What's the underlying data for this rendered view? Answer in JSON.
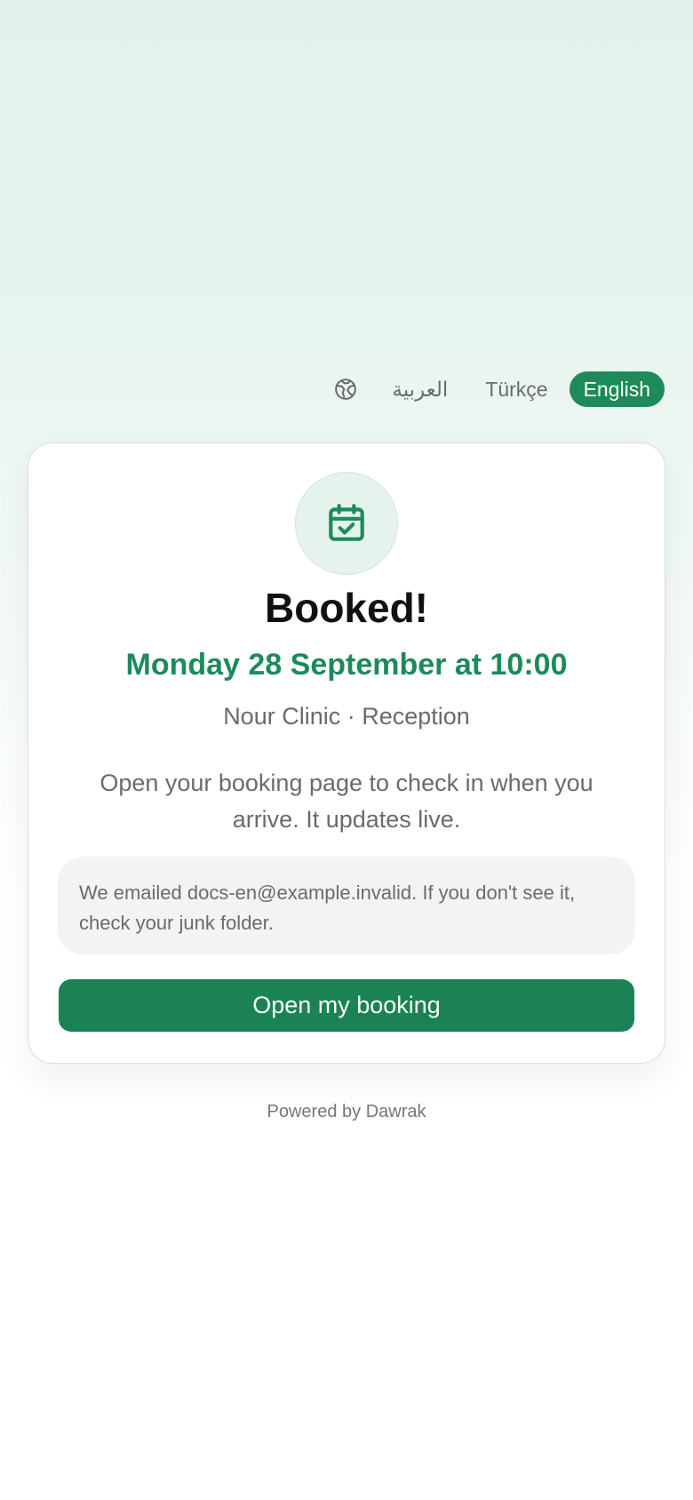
{
  "language_switcher": {
    "icon": "globe-icon",
    "options": [
      {
        "label": "العربية",
        "active": false
      },
      {
        "label": "Türkçe",
        "active": false
      },
      {
        "label": "English",
        "active": true
      }
    ]
  },
  "confirmation": {
    "icon": "calendar-check-icon",
    "title": "Booked!",
    "datetime": "Monday 28 September at 10:00",
    "location": "Nour Clinic · Reception",
    "message": "Open your booking page to check in when you arrive. It updates live.",
    "notice": "We emailed docs-en@example.invalid. If you don't see it, check your junk folder.",
    "button_label": "Open my booking"
  },
  "footer": {
    "text": "Powered by Dawrak"
  },
  "colors": {
    "accent": "#1d8a5a",
    "button": "#1a8254",
    "muted_text": "#6b6b6b"
  }
}
